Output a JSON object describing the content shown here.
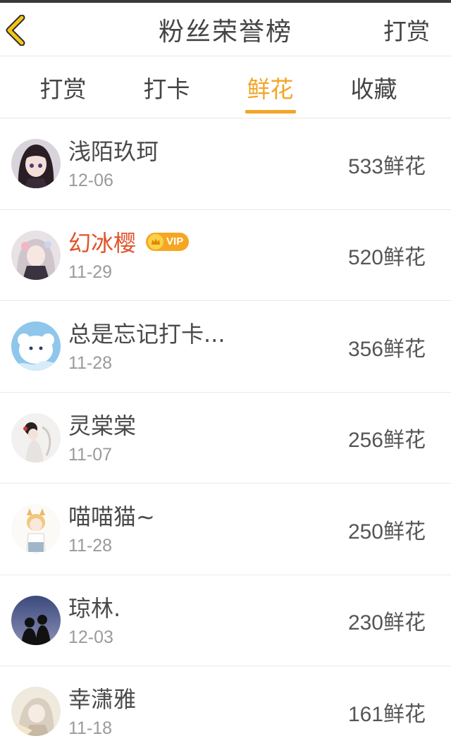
{
  "header": {
    "title": "粉丝荣誉榜",
    "action_label": "打赏",
    "back_icon": "chevron-left-icon"
  },
  "tabs": [
    {
      "label": "打赏",
      "active": false
    },
    {
      "label": "打卡",
      "active": false
    },
    {
      "label": "鲜花",
      "active": true
    },
    {
      "label": "收藏",
      "active": false
    }
  ],
  "colors": {
    "accent": "#f3a527",
    "vip_name": "#e0532b",
    "back_icon": "#f5c518"
  },
  "fans": [
    {
      "name": "浅陌玖珂",
      "date": "12-06",
      "count": "533鲜花",
      "vip": false
    },
    {
      "name": "幻冰樱",
      "date": "11-29",
      "count": "520鲜花",
      "vip": true,
      "vip_label": "VIP"
    },
    {
      "name": "总是忘记打卡...",
      "date": "11-28",
      "count": "356鲜花",
      "vip": false
    },
    {
      "name": "灵棠棠",
      "date": "11-07",
      "count": "256鲜花",
      "vip": false
    },
    {
      "name": "喵喵猫~",
      "date": "11-28",
      "count": "250鲜花",
      "vip": false
    },
    {
      "name": "琼林.",
      "date": "12-03",
      "count": "230鲜花",
      "vip": false
    },
    {
      "name": "幸潇雅",
      "date": "11-18",
      "count": "161鲜花",
      "vip": false
    }
  ]
}
